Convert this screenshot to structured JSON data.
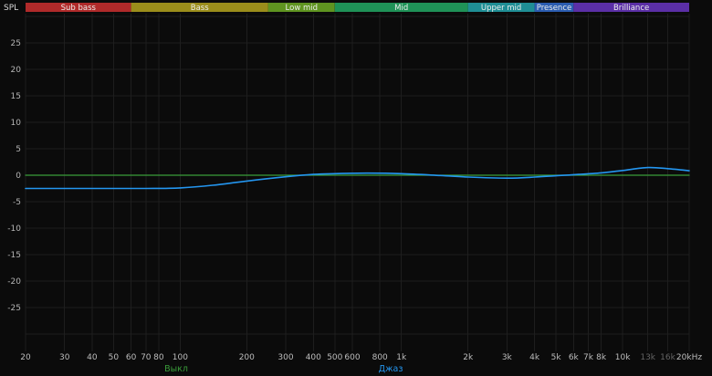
{
  "chart_data": {
    "type": "line",
    "ylabel": "SPL",
    "x_scale": "log",
    "x_unit": "Hz",
    "x_range": [
      20,
      20000
    ],
    "y_range": [
      -25,
      25
    ],
    "grid": true,
    "legend_position": "bottom",
    "colors": {
      "background": "#0b0b0b",
      "grid": "#1e1e1e",
      "tick_text": "#bdbdbd",
      "tick_text_dim": "#646464"
    },
    "y_ticks": [
      {
        "value": 25,
        "label": "25"
      },
      {
        "value": 20,
        "label": "20"
      },
      {
        "value": 15,
        "label": "15"
      },
      {
        "value": 10,
        "label": "10"
      },
      {
        "value": 5,
        "label": "5"
      },
      {
        "value": 0,
        "label": "0"
      },
      {
        "value": -5,
        "label": "-5"
      },
      {
        "value": -10,
        "label": "-10"
      },
      {
        "value": -15,
        "label": "-15"
      },
      {
        "value": -20,
        "label": "-20"
      },
      {
        "value": -25,
        "label": "-25"
      }
    ],
    "x_ticks": [
      {
        "f": 20,
        "label": "20",
        "dim": false
      },
      {
        "f": 30,
        "label": "30",
        "dim": false
      },
      {
        "f": 40,
        "label": "40",
        "dim": false
      },
      {
        "f": 50,
        "label": "50",
        "dim": false
      },
      {
        "f": 60,
        "label": "60",
        "dim": false
      },
      {
        "f": 70,
        "label": "70",
        "dim": false
      },
      {
        "f": 80,
        "label": "80",
        "dim": false
      },
      {
        "f": 100,
        "label": "100",
        "dim": false
      },
      {
        "f": 200,
        "label": "200",
        "dim": false
      },
      {
        "f": 300,
        "label": "300",
        "dim": false
      },
      {
        "f": 400,
        "label": "400",
        "dim": false
      },
      {
        "f": 500,
        "label": "500",
        "dim": false
      },
      {
        "f": 600,
        "label": "600",
        "dim": false
      },
      {
        "f": 800,
        "label": "800",
        "dim": false
      },
      {
        "f": 1000,
        "label": "1k",
        "dim": false
      },
      {
        "f": 2000,
        "label": "2k",
        "dim": false
      },
      {
        "f": 3000,
        "label": "3k",
        "dim": false
      },
      {
        "f": 4000,
        "label": "4k",
        "dim": false
      },
      {
        "f": 5000,
        "label": "5k",
        "dim": false
      },
      {
        "f": 6000,
        "label": "6k",
        "dim": false
      },
      {
        "f": 7000,
        "label": "7k",
        "dim": false
      },
      {
        "f": 8000,
        "label": "8k",
        "dim": false
      },
      {
        "f": 10000,
        "label": "10k",
        "dim": false
      },
      {
        "f": 13000,
        "label": "13k",
        "dim": true
      },
      {
        "f": 16000,
        "label": "16k",
        "dim": true
      },
      {
        "f": 20000,
        "label": "20kHz",
        "dim": false
      }
    ],
    "frequency_bands": [
      {
        "label": "Sub bass",
        "from": 20,
        "to": 60,
        "color": "#b02a2a"
      },
      {
        "label": "Bass",
        "from": 60,
        "to": 250,
        "color": "#9b8d1b"
      },
      {
        "label": "Low mid",
        "from": 250,
        "to": 500,
        "color": "#5f9420"
      },
      {
        "label": "Mid",
        "from": 500,
        "to": 2000,
        "color": "#1f9257"
      },
      {
        "label": "Upper mid",
        "from": 2000,
        "to": 4000,
        "color": "#1f8e95"
      },
      {
        "label": "Presence",
        "from": 4000,
        "to": 6000,
        "color": "#2b5cb0"
      },
      {
        "label": "Brilliance",
        "from": 6000,
        "to": 20000,
        "color": "#5b2fa6"
      }
    ],
    "series": [
      {
        "name": "Выкл",
        "color": "#3a9c3a",
        "points": [
          [
            20,
            0
          ],
          [
            20000,
            0
          ]
        ]
      },
      {
        "name": "Джаз",
        "color": "#2496f0",
        "points": [
          [
            20,
            -2.5
          ],
          [
            40,
            -2.5
          ],
          [
            70,
            -2.5
          ],
          [
            100,
            -2.4
          ],
          [
            140,
            -1.9
          ],
          [
            200,
            -1.1
          ],
          [
            300,
            -0.3
          ],
          [
            400,
            0.15
          ],
          [
            500,
            0.3
          ],
          [
            700,
            0.4
          ],
          [
            1000,
            0.3
          ],
          [
            1500,
            -0.05
          ],
          [
            2000,
            -0.35
          ],
          [
            3000,
            -0.55
          ],
          [
            4000,
            -0.35
          ],
          [
            5000,
            -0.1
          ],
          [
            6000,
            0.1
          ],
          [
            8000,
            0.45
          ],
          [
            10000,
            0.9
          ],
          [
            13000,
            1.45
          ],
          [
            16000,
            1.25
          ],
          [
            20000,
            0.85
          ]
        ]
      }
    ]
  }
}
